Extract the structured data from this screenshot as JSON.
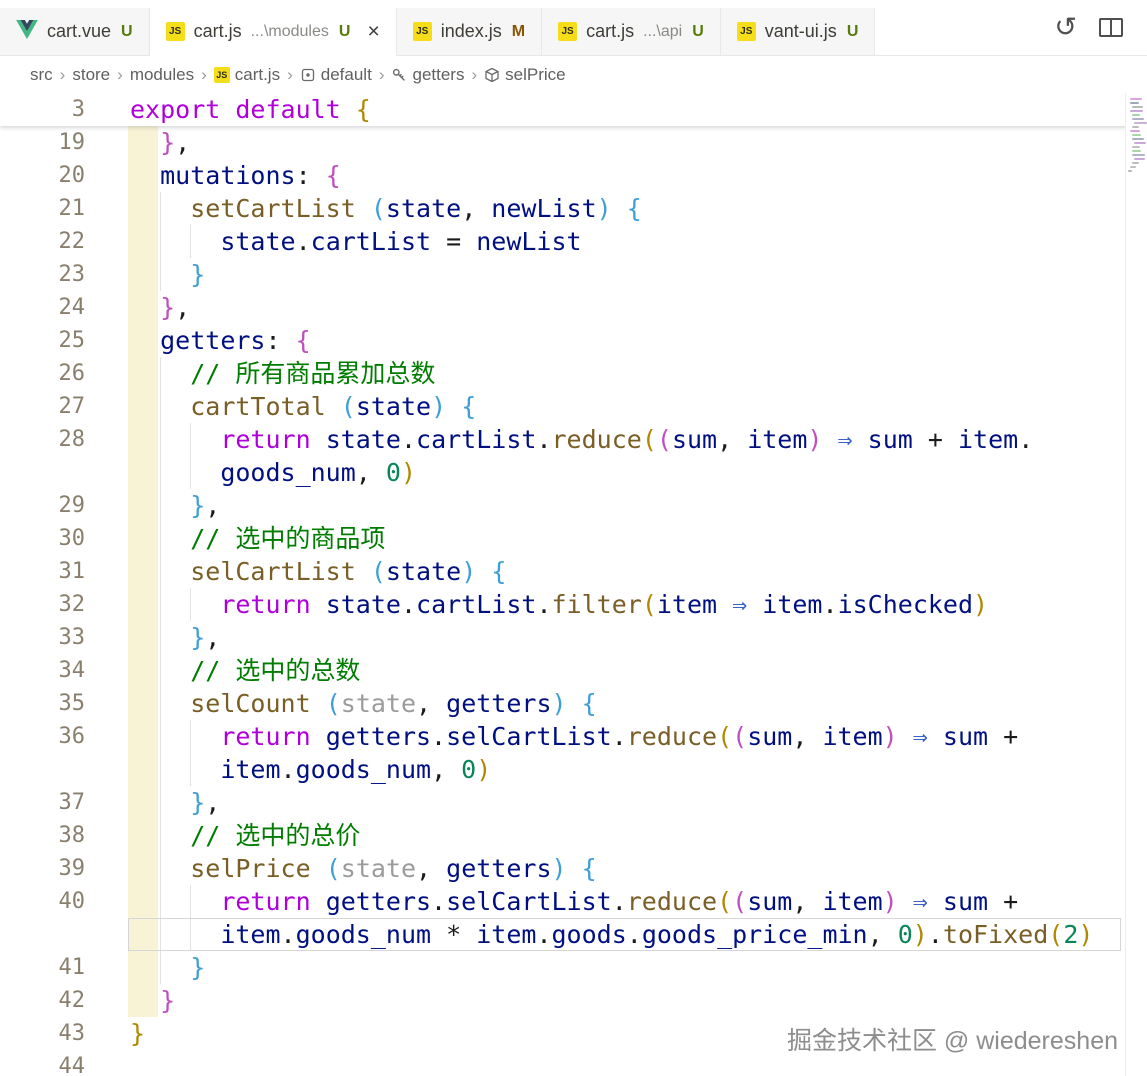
{
  "tab_bar": {
    "tabs": [
      {
        "id": "cart-vue",
        "icon": "vue",
        "label": "cart.vue",
        "desc": "",
        "badge": "U",
        "active": false
      },
      {
        "id": "cart-js-modules",
        "icon": "js",
        "label": "cart.js",
        "desc": "...\\modules",
        "badge": "U",
        "active": true
      },
      {
        "id": "index-js",
        "icon": "js",
        "label": "index.js",
        "desc": "",
        "badge": "M",
        "active": false
      },
      {
        "id": "cart-js-api",
        "icon": "js",
        "label": "cart.js",
        "desc": "...\\api",
        "badge": "U",
        "active": false
      },
      {
        "id": "vant-ui-js",
        "icon": "js",
        "label": "vant-ui.js",
        "desc": "",
        "badge": "U",
        "active": false
      }
    ],
    "close_label": "×",
    "badge_colors": {
      "untracked": "#587c0c",
      "modified": "#895503"
    },
    "actions": [
      {
        "id": "quote",
        "glyph": "“"
      },
      {
        "id": "open-timeline",
        "glyph": "↺"
      },
      {
        "id": "split-editor",
        "glyph": ""
      }
    ]
  },
  "breadcrumb": {
    "separator": "›",
    "items": [
      {
        "label": "src",
        "icon": ""
      },
      {
        "label": "store",
        "icon": ""
      },
      {
        "label": "modules",
        "icon": ""
      },
      {
        "label": "cart.js",
        "icon": "js"
      },
      {
        "label": "default",
        "icon": "symbol-default"
      },
      {
        "label": "getters",
        "icon": "symbol-key"
      },
      {
        "label": "selPrice",
        "icon": "symbol-cube"
      }
    ]
  },
  "syntax_colors": {
    "keyword": "#AF00DB",
    "property": "#001080",
    "variable": "#001080",
    "function": "#795E26",
    "comment": "#007c00",
    "number": "#098658",
    "text": "#1b1b1b",
    "dim_param": "#9b9b9b",
    "arrow": "#3a62c8",
    "bracket_gold": "#b08800",
    "bracket_purple": "#bf4fbf",
    "bracket_blue": "#3d9fd6",
    "changed_line_gutter": "#f9f3d6",
    "line_number": "#8a7f6d"
  },
  "editor": {
    "sticky": {
      "n": "3",
      "t": [
        [
          "kw",
          "export"
        ],
        [
          "tx",
          " "
        ],
        [
          "kw",
          "default"
        ],
        [
          "tx",
          " "
        ],
        [
          "b1",
          "{"
        ]
      ]
    },
    "rows": [
      {
        "n": "19",
        "chg": true,
        "g": [],
        "t": [
          [
            "tx",
            "  "
          ],
          [
            "b2",
            "}"
          ],
          [
            "tx",
            ","
          ]
        ]
      },
      {
        "n": "20",
        "chg": true,
        "g": [],
        "t": [
          [
            "tx",
            "  "
          ],
          [
            "pr",
            "mutations"
          ],
          [
            "tx",
            ": "
          ],
          [
            "b2",
            "{"
          ]
        ]
      },
      {
        "n": "21",
        "chg": true,
        "g": [
          2
        ],
        "t": [
          [
            "tx",
            "    "
          ],
          [
            "fn",
            "setCartList"
          ],
          [
            "tx",
            " "
          ],
          [
            "b3",
            "("
          ],
          [
            "vr",
            "state"
          ],
          [
            "tx",
            ", "
          ],
          [
            "vr",
            "newList"
          ],
          [
            "b3",
            ")"
          ],
          [
            "tx",
            " "
          ],
          [
            "b3",
            "{"
          ]
        ]
      },
      {
        "n": "22",
        "chg": true,
        "g": [
          2,
          4
        ],
        "t": [
          [
            "tx",
            "      "
          ],
          [
            "vr",
            "state"
          ],
          [
            "tx",
            "."
          ],
          [
            "vr",
            "cartList"
          ],
          [
            "tx",
            " = "
          ],
          [
            "vr",
            "newList"
          ]
        ]
      },
      {
        "n": "23",
        "chg": true,
        "g": [
          2
        ],
        "t": [
          [
            "tx",
            "    "
          ],
          [
            "b3",
            "}"
          ]
        ]
      },
      {
        "n": "24",
        "chg": true,
        "g": [],
        "t": [
          [
            "tx",
            "  "
          ],
          [
            "b2",
            "}"
          ],
          [
            "tx",
            ","
          ]
        ]
      },
      {
        "n": "25",
        "chg": true,
        "g": [],
        "t": [
          [
            "tx",
            "  "
          ],
          [
            "pr",
            "getters"
          ],
          [
            "tx",
            ": "
          ],
          [
            "b2",
            "{"
          ]
        ]
      },
      {
        "n": "26",
        "chg": true,
        "g": [
          2
        ],
        "t": [
          [
            "tx",
            "    "
          ],
          [
            "cm",
            "// 所有商品累加总数"
          ]
        ]
      },
      {
        "n": "27",
        "chg": true,
        "g": [
          2
        ],
        "t": [
          [
            "tx",
            "    "
          ],
          [
            "fn",
            "cartTotal"
          ],
          [
            "tx",
            " "
          ],
          [
            "b3",
            "("
          ],
          [
            "vr",
            "state"
          ],
          [
            "b3",
            ")"
          ],
          [
            "tx",
            " "
          ],
          [
            "b3",
            "{"
          ]
        ]
      },
      {
        "n": "28",
        "chg": true,
        "g": [
          2,
          4
        ],
        "t": [
          [
            "tx",
            "      "
          ],
          [
            "kw",
            "return"
          ],
          [
            "tx",
            " "
          ],
          [
            "vr",
            "state"
          ],
          [
            "tx",
            "."
          ],
          [
            "vr",
            "cartList"
          ],
          [
            "tx",
            "."
          ],
          [
            "fn",
            "reduce"
          ],
          [
            "b1",
            "("
          ],
          [
            "b2",
            "("
          ],
          [
            "vr",
            "sum"
          ],
          [
            "tx",
            ", "
          ],
          [
            "vr",
            "item"
          ],
          [
            "b2",
            ")"
          ],
          [
            "tx",
            " "
          ],
          [
            "ar",
            "⇒"
          ],
          [
            "tx",
            " "
          ],
          [
            "vr",
            "sum"
          ],
          [
            "tx",
            " + "
          ],
          [
            "vr",
            "item"
          ],
          [
            "tx",
            "."
          ]
        ]
      },
      {
        "n": "",
        "chg": true,
        "g": [
          2,
          4
        ],
        "t": [
          [
            "tx",
            "      "
          ],
          [
            "vr",
            "goods_num"
          ],
          [
            "tx",
            ", "
          ],
          [
            "nm",
            "0"
          ],
          [
            "b1",
            ")"
          ]
        ]
      },
      {
        "n": "29",
        "chg": true,
        "g": [
          2
        ],
        "t": [
          [
            "tx",
            "    "
          ],
          [
            "b3",
            "}"
          ],
          [
            "tx",
            ","
          ]
        ]
      },
      {
        "n": "30",
        "chg": true,
        "g": [
          2
        ],
        "t": [
          [
            "tx",
            "    "
          ],
          [
            "cm",
            "// 选中的商品项"
          ]
        ]
      },
      {
        "n": "31",
        "chg": true,
        "g": [
          2
        ],
        "t": [
          [
            "tx",
            "    "
          ],
          [
            "fn",
            "selCartList"
          ],
          [
            "tx",
            " "
          ],
          [
            "b3",
            "("
          ],
          [
            "vr",
            "state"
          ],
          [
            "b3",
            ")"
          ],
          [
            "tx",
            " "
          ],
          [
            "b3",
            "{"
          ]
        ]
      },
      {
        "n": "32",
        "chg": true,
        "g": [
          2,
          4
        ],
        "t": [
          [
            "tx",
            "      "
          ],
          [
            "kw",
            "return"
          ],
          [
            "tx",
            " "
          ],
          [
            "vr",
            "state"
          ],
          [
            "tx",
            "."
          ],
          [
            "vr",
            "cartList"
          ],
          [
            "tx",
            "."
          ],
          [
            "fn",
            "filter"
          ],
          [
            "b1",
            "("
          ],
          [
            "vr",
            "item"
          ],
          [
            "tx",
            " "
          ],
          [
            "ar",
            "⇒"
          ],
          [
            "tx",
            " "
          ],
          [
            "vr",
            "item"
          ],
          [
            "tx",
            "."
          ],
          [
            "vr",
            "isChecked"
          ],
          [
            "b1",
            ")"
          ]
        ]
      },
      {
        "n": "33",
        "chg": true,
        "g": [
          2
        ],
        "t": [
          [
            "tx",
            "    "
          ],
          [
            "b3",
            "}"
          ],
          [
            "tx",
            ","
          ]
        ]
      },
      {
        "n": "34",
        "chg": true,
        "g": [
          2
        ],
        "t": [
          [
            "tx",
            "    "
          ],
          [
            "cm",
            "// 选中的总数"
          ]
        ]
      },
      {
        "n": "35",
        "chg": true,
        "g": [
          2
        ],
        "t": [
          [
            "tx",
            "    "
          ],
          [
            "fn",
            "selCount"
          ],
          [
            "tx",
            " "
          ],
          [
            "b3",
            "("
          ],
          [
            "dm",
            "state"
          ],
          [
            "tx",
            ", "
          ],
          [
            "vr",
            "getters"
          ],
          [
            "b3",
            ")"
          ],
          [
            "tx",
            " "
          ],
          [
            "b3",
            "{"
          ]
        ]
      },
      {
        "n": "36",
        "chg": true,
        "g": [
          2,
          4
        ],
        "t": [
          [
            "tx",
            "      "
          ],
          [
            "kw",
            "return"
          ],
          [
            "tx",
            " "
          ],
          [
            "vr",
            "getters"
          ],
          [
            "tx",
            "."
          ],
          [
            "vr",
            "selCartList"
          ],
          [
            "tx",
            "."
          ],
          [
            "fn",
            "reduce"
          ],
          [
            "b1",
            "("
          ],
          [
            "b2",
            "("
          ],
          [
            "vr",
            "sum"
          ],
          [
            "tx",
            ", "
          ],
          [
            "vr",
            "item"
          ],
          [
            "b2",
            ")"
          ],
          [
            "tx",
            " "
          ],
          [
            "ar",
            "⇒"
          ],
          [
            "tx",
            " "
          ],
          [
            "vr",
            "sum"
          ],
          [
            "tx",
            " +"
          ]
        ]
      },
      {
        "n": "",
        "chg": true,
        "g": [
          2,
          4
        ],
        "t": [
          [
            "tx",
            "      "
          ],
          [
            "vr",
            "item"
          ],
          [
            "tx",
            "."
          ],
          [
            "vr",
            "goods_num"
          ],
          [
            "tx",
            ", "
          ],
          [
            "nm",
            "0"
          ],
          [
            "b1",
            ")"
          ]
        ]
      },
      {
        "n": "37",
        "chg": true,
        "g": [
          2
        ],
        "t": [
          [
            "tx",
            "    "
          ],
          [
            "b3",
            "}"
          ],
          [
            "tx",
            ","
          ]
        ]
      },
      {
        "n": "38",
        "chg": true,
        "g": [
          2
        ],
        "t": [
          [
            "tx",
            "    "
          ],
          [
            "cm",
            "// 选中的总价"
          ]
        ]
      },
      {
        "n": "39",
        "chg": true,
        "g": [
          2
        ],
        "t": [
          [
            "tx",
            "    "
          ],
          [
            "fn",
            "selPrice"
          ],
          [
            "tx",
            " "
          ],
          [
            "b3",
            "("
          ],
          [
            "dm",
            "state"
          ],
          [
            "tx",
            ", "
          ],
          [
            "vr",
            "getters"
          ],
          [
            "b3",
            ")"
          ],
          [
            "tx",
            " "
          ],
          [
            "b3",
            "{"
          ]
        ]
      },
      {
        "n": "40",
        "chg": true,
        "g": [
          2,
          4
        ],
        "t": [
          [
            "tx",
            "      "
          ],
          [
            "kw",
            "return"
          ],
          [
            "tx",
            " "
          ],
          [
            "vr",
            "getters"
          ],
          [
            "tx",
            "."
          ],
          [
            "vr",
            "selCartList"
          ],
          [
            "tx",
            "."
          ],
          [
            "fn",
            "reduce"
          ],
          [
            "b1",
            "("
          ],
          [
            "b2",
            "("
          ],
          [
            "vr",
            "sum"
          ],
          [
            "tx",
            ", "
          ],
          [
            "vr",
            "item"
          ],
          [
            "b2",
            ")"
          ],
          [
            "tx",
            " "
          ],
          [
            "ar",
            "⇒"
          ],
          [
            "tx",
            " "
          ],
          [
            "vr",
            "sum"
          ],
          [
            "tx",
            " +"
          ]
        ]
      },
      {
        "n": "",
        "chg": true,
        "cur": true,
        "g": [
          2,
          4
        ],
        "t": [
          [
            "tx",
            "      "
          ],
          [
            "vr",
            "item"
          ],
          [
            "tx",
            "."
          ],
          [
            "vr",
            "goods_num"
          ],
          [
            "tx",
            " * "
          ],
          [
            "vr",
            "item"
          ],
          [
            "tx",
            "."
          ],
          [
            "vr",
            "goods"
          ],
          [
            "tx",
            "."
          ],
          [
            "vr",
            "goods_price_min"
          ],
          [
            "tx",
            ", "
          ],
          [
            "nm",
            "0"
          ],
          [
            "b1",
            ")"
          ],
          [
            "tx",
            "."
          ],
          [
            "fn",
            "toFixed"
          ],
          [
            "b1",
            "("
          ],
          [
            "nm",
            "2"
          ],
          [
            "b1",
            ")"
          ]
        ]
      },
      {
        "n": "41",
        "chg": true,
        "g": [
          2
        ],
        "t": [
          [
            "tx",
            "    "
          ],
          [
            "b3",
            "}"
          ]
        ]
      },
      {
        "n": "42",
        "chg": true,
        "g": [],
        "t": [
          [
            "tx",
            "  "
          ],
          [
            "b2",
            "}"
          ]
        ]
      },
      {
        "n": "43",
        "chg": false,
        "g": [],
        "t": [
          [
            "b1",
            "}"
          ]
        ]
      },
      {
        "n": "44",
        "chg": false,
        "g": [],
        "t": []
      }
    ]
  },
  "minimap": {
    "bars": [
      {
        "i": 2,
        "w": 12,
        "c": "#d9a6e0"
      },
      {
        "i": 2,
        "w": 9,
        "c": "#9fa8b8"
      },
      {
        "i": 4,
        "w": 11,
        "c": "#b9b9b9"
      },
      {
        "i": 2,
        "w": 13,
        "c": "#caa9e0"
      },
      {
        "i": 4,
        "w": 8,
        "c": "#a7d7a7"
      },
      {
        "i": 4,
        "w": 12,
        "c": "#b0b0c8"
      },
      {
        "i": 6,
        "w": 13,
        "c": "#c5b3d8"
      },
      {
        "i": 4,
        "w": 7,
        "c": "#bcbcbc"
      },
      {
        "i": 2,
        "w": 10,
        "c": "#d9a6e0"
      },
      {
        "i": 4,
        "w": 9,
        "c": "#a7d7a7"
      },
      {
        "i": 4,
        "w": 12,
        "c": "#adadc0"
      },
      {
        "i": 6,
        "w": 12,
        "c": "#c9a9da"
      },
      {
        "i": 4,
        "w": 8,
        "c": "#c0c0c0"
      },
      {
        "i": 4,
        "w": 9,
        "c": "#a7d7a7"
      },
      {
        "i": 4,
        "w": 13,
        "c": "#b3b3cc"
      },
      {
        "i": 6,
        "w": 11,
        "c": "#c9a9da"
      },
      {
        "i": 4,
        "w": 7,
        "c": "#bcbcbc"
      },
      {
        "i": 2,
        "w": 6,
        "c": "#c0c0c0"
      },
      {
        "i": 0,
        "w": 4,
        "c": "#b8b8b8"
      }
    ]
  },
  "watermark": "掘金技术社区 @ wiedereshen"
}
